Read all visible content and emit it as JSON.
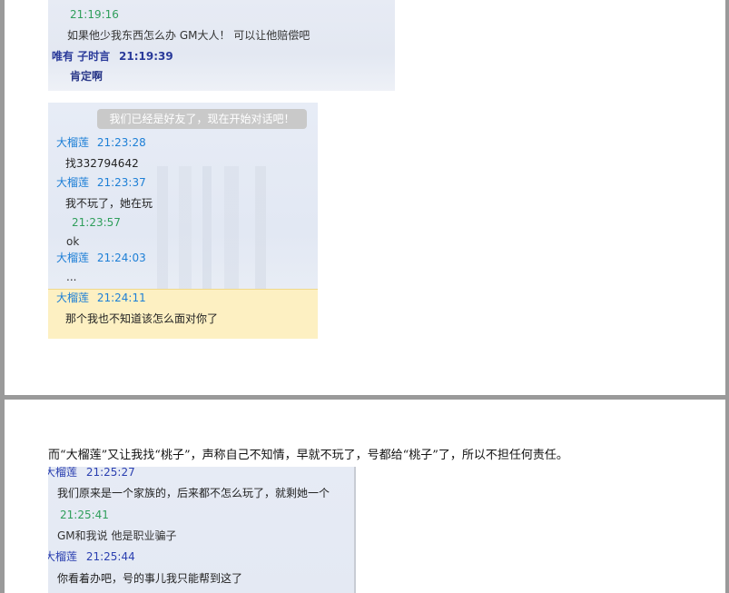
{
  "screenshot1": {
    "lines": [
      {
        "time": "21:19:16"
      },
      {
        "text": "如果他少我东西怎么办 GM大人！ 可以让他赔偿吧"
      },
      {
        "name": "唯有 子时言",
        "time": "21:19:39"
      },
      {
        "text": "肯定啊"
      }
    ]
  },
  "screenshot2": {
    "notice": "我们已经是好友了，现在开始对话吧！",
    "messages": [
      {
        "name": "大榴莲",
        "time": "21:23:28",
        "text": "找332794642"
      },
      {
        "name": "大榴莲",
        "time": "21:23:37",
        "text": "我不玩了，她在玩"
      },
      {
        "name": "",
        "time": "21:23:57",
        "text": "ok"
      },
      {
        "name": "大榴莲",
        "time": "21:24:03",
        "text": "..."
      },
      {
        "name": "大榴莲",
        "time": "21:24:11",
        "text": "那个我也不知道该怎么面对你了"
      }
    ]
  },
  "caption": "而“大榴莲”又让我找“桃子”，声称自己不知情，早就不玩了，号都给“桃子”了，所以不担任何责任。",
  "screenshot3": {
    "messages": [
      {
        "name": "大榴莲",
        "time": "21:25:27",
        "text": "我们原来是一个家族的，后来都不怎么玩了，就剩她一个"
      },
      {
        "name": "",
        "time": "21:25:41",
        "text": "GM和我说 他是职业骗子"
      },
      {
        "name": "大榴莲",
        "time": "21:25:44",
        "text": "你看着办吧，号的事儿我只能帮到这了"
      }
    ]
  }
}
